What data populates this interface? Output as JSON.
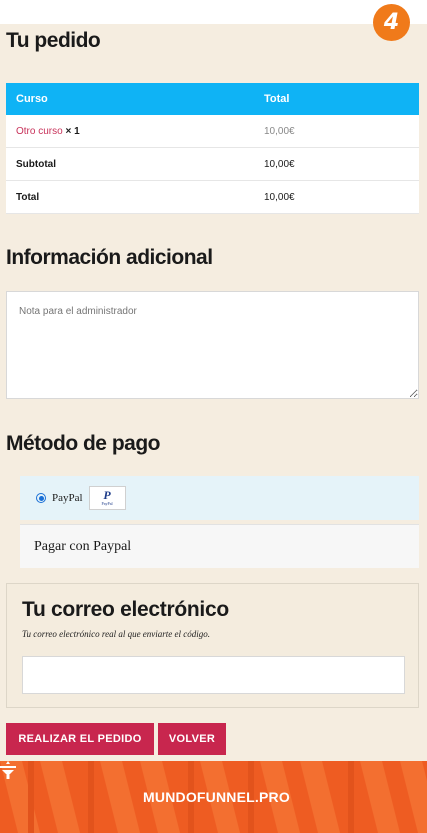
{
  "header": {
    "brand_badge_letter": "4"
  },
  "order": {
    "title": "Tu pedido",
    "columns": [
      "Curso",
      "Total"
    ],
    "item": {
      "name": "Otro curso",
      "qty": "× 1",
      "total": "10,00€"
    },
    "subtotal": {
      "label": "Subtotal",
      "value": "10,00€"
    },
    "total": {
      "label": "Total",
      "value": "10,00€"
    }
  },
  "additional": {
    "title": "Información adicional",
    "notes_placeholder": "Nota para el administrador"
  },
  "payment": {
    "title": "Método de pago",
    "option_label": "PayPal",
    "paypal_logo_text": "PayPal",
    "description": "Pagar con Paypal"
  },
  "email": {
    "title": "Tu correo electrónico",
    "subtitle": "Tu correo electrónico real al que enviarte el código.",
    "value": ""
  },
  "actions": {
    "place_order": "REALIZAR EL PEDIDO",
    "back": "VOLVER"
  },
  "footer": {
    "brand": "MUNDOFUNNEL.PRO"
  },
  "colors": {
    "accent_blue": "#0fb3f5",
    "button_red": "#c8264e",
    "footer_orange": "#ee5c22",
    "page_bg": "#f5ede0"
  }
}
